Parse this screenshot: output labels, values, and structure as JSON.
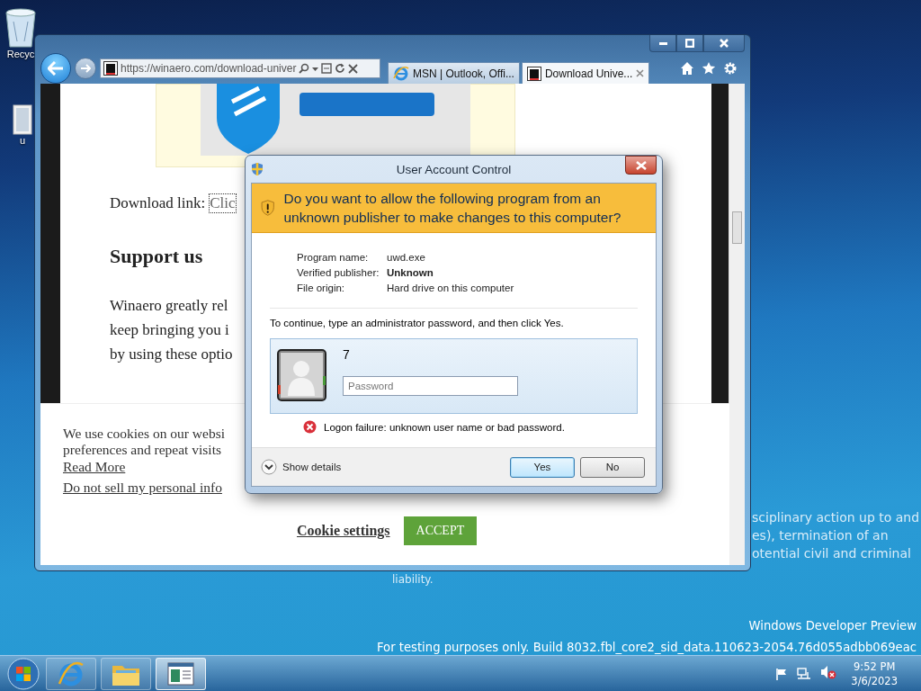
{
  "desktop": {
    "icons": [
      {
        "kind": "recycle-bin",
        "label": "Recyc"
      },
      {
        "kind": "file",
        "label": "u"
      }
    ],
    "background_text": [
      "sciplinary action up to and",
      "es), termination of an",
      "otential civil and criminal",
      "liability."
    ],
    "watermark": [
      "Windows Developer Preview",
      "For testing purposes only. Build 8032.fbl_core2_sid_data.110623-2054.76d055adbb069eac"
    ]
  },
  "browser": {
    "address": "https://winaero.com/download-univer",
    "tabs": [
      {
        "kind": "ie",
        "label": "MSN | Outlook, Offi...",
        "selected": false
      },
      {
        "kind": "site",
        "label": "Download Unive...",
        "selected": true
      }
    ],
    "page": {
      "download_label": "Download link:",
      "download_link": "Clic",
      "heading": "Support us",
      "paragraph": [
        "Winaero greatly rel",
        "keep bringing you i",
        "by using these optio"
      ]
    },
    "cookie_banner": {
      "text": [
        "We use cookies on our websi",
        "preferences and repeat visits"
      ],
      "read_more": "Read More",
      "do_not_sell": "Do not sell my personal info",
      "settings": "Cookie settings",
      "accept": "ACCEPT"
    }
  },
  "uac": {
    "title": "User Account Control",
    "question": "Do you want to allow the following program from an unknown publisher to make changes to this computer?",
    "details": [
      {
        "label": "Program name:",
        "value": "uwd.exe",
        "emphasized": false
      },
      {
        "label": "Verified publisher:",
        "value": "Unknown",
        "emphasized": true
      },
      {
        "label": "File origin:",
        "value": "Hard drive on this computer",
        "emphasized": false
      }
    ],
    "instruction": "To continue, type an administrator password, and then click Yes.",
    "user": {
      "name": "7",
      "password": {
        "placeholder": "Password"
      }
    },
    "error": "Logon failure: unknown user name or bad password.",
    "show_details": {
      "label": "Show details",
      "expanded": false
    },
    "buttons": [
      {
        "label": "Yes",
        "focused": true
      },
      {
        "label": "No",
        "focused": false
      }
    ]
  },
  "taskbar": {
    "apps": [
      {
        "kind": "ie",
        "selected": false
      },
      {
        "kind": "explorer",
        "selected": false
      },
      {
        "kind": "window",
        "selected": true
      }
    ],
    "tray": {
      "volume_muted": true,
      "time": "9:52 PM",
      "date": "3/6/2023"
    }
  }
}
